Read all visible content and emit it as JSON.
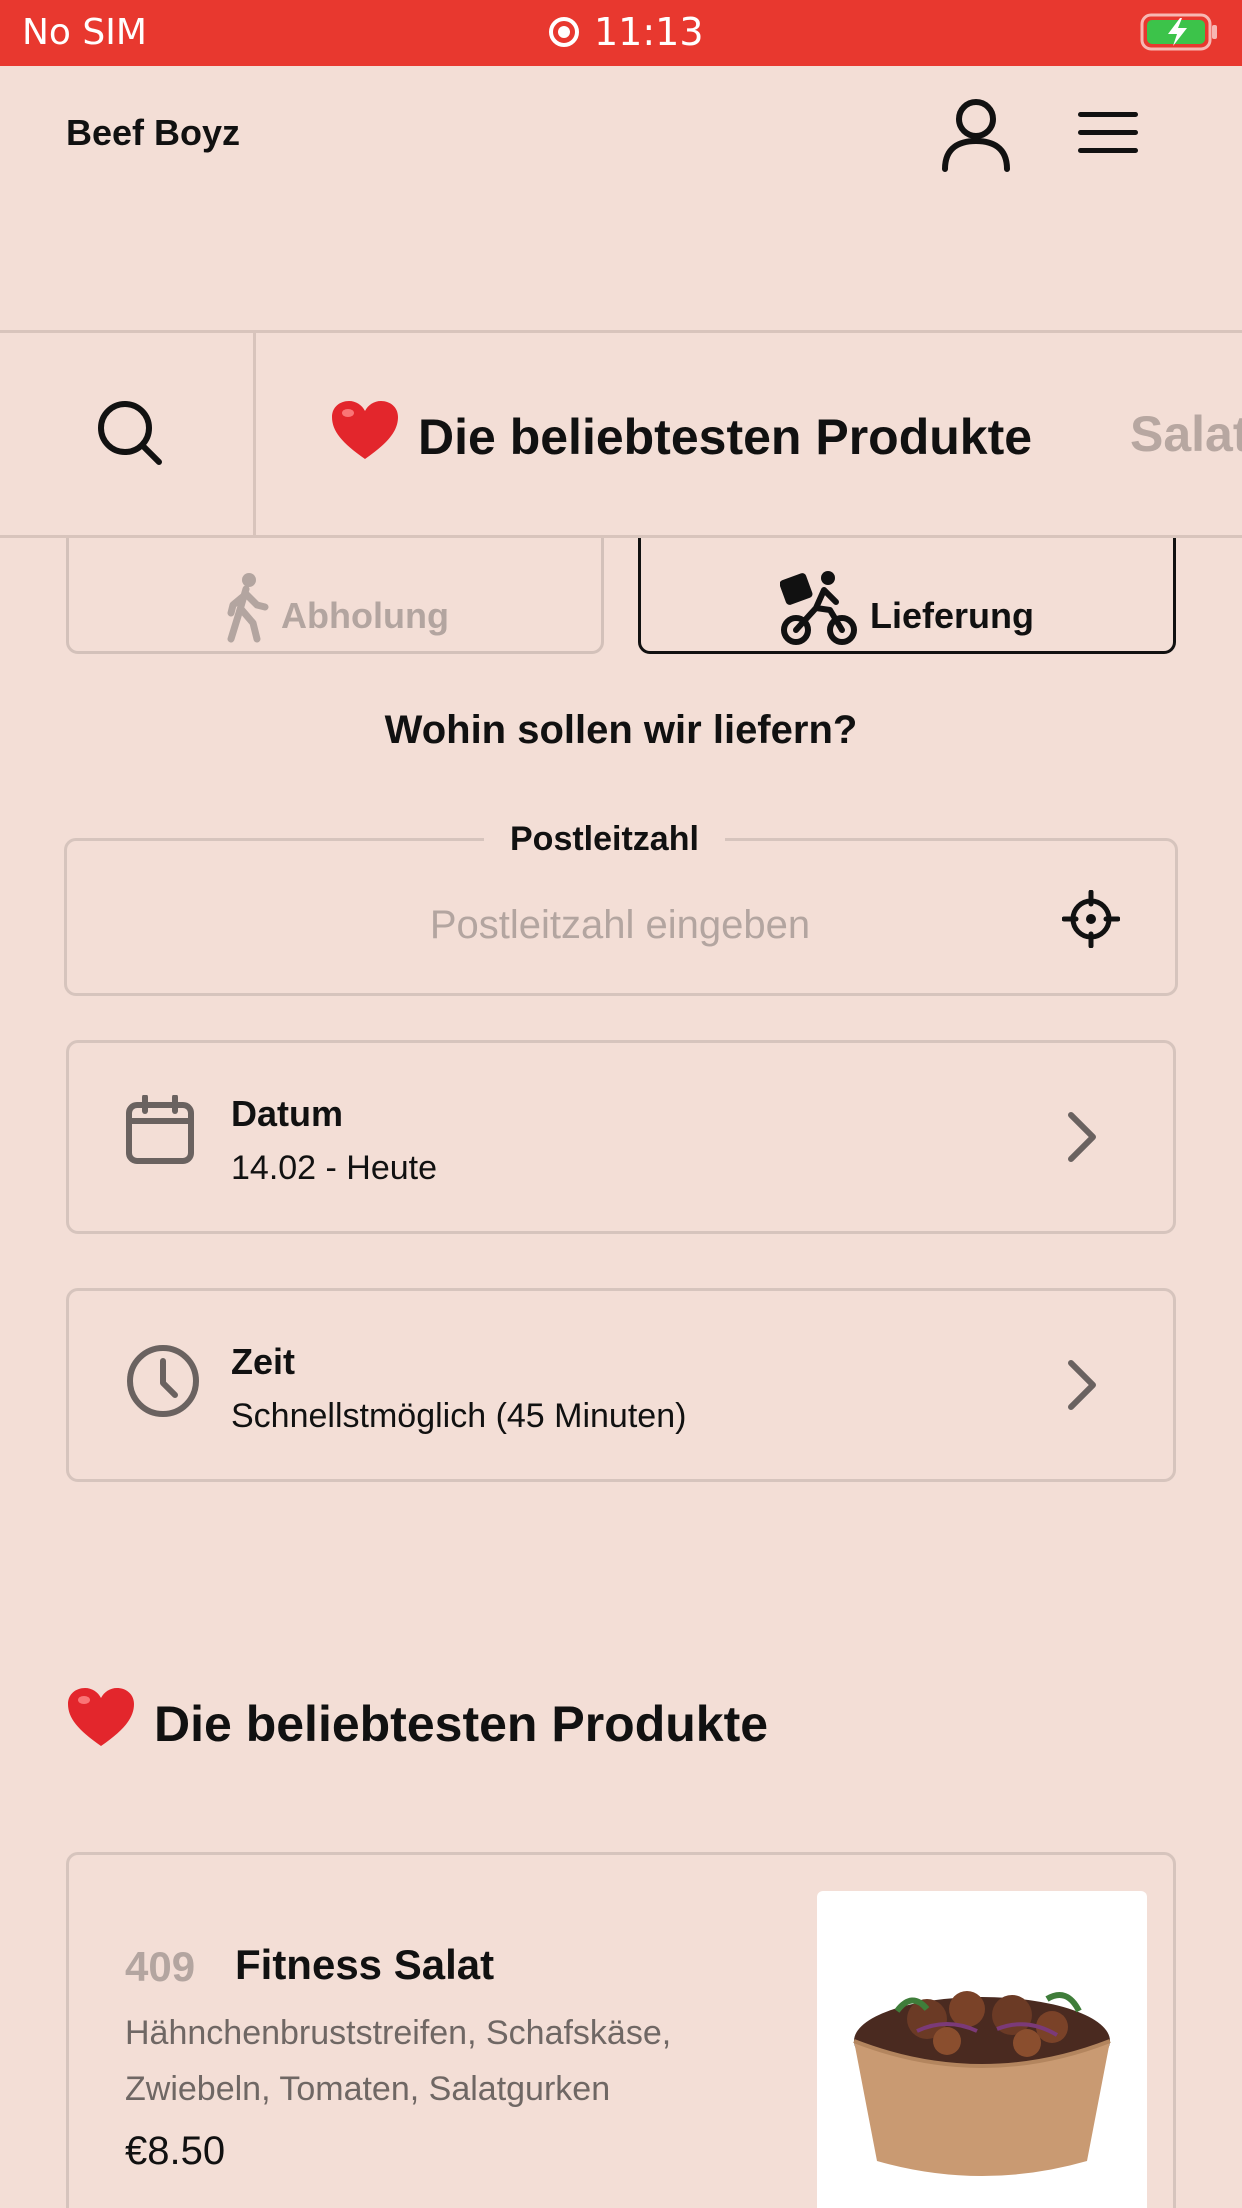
{
  "status_bar": {
    "carrier": "No SIM",
    "time": "11:13",
    "battery_color": "#3cc34a"
  },
  "header": {
    "brand": "Beef Boyz",
    "account_icon": "user-icon",
    "menu_icon": "hamburger-menu-icon"
  },
  "category_bar": {
    "search_icon": "search-icon",
    "active_emoji": "❤️",
    "active_label": "Die beliebtesten Produkte",
    "next_label": "Salat"
  },
  "mode_tabs": {
    "pickup_label": "Abholung",
    "delivery_label": "Lieferung",
    "selected": "delivery"
  },
  "delivery_form": {
    "question": "Wohin sollen wir liefern?",
    "postal_legend": "Postleitzahl",
    "postal_value": "",
    "postal_placeholder": "Postleitzahl eingeben",
    "date_title": "Datum",
    "date_value": "14.02 - Heute",
    "time_title": "Zeit",
    "time_value": "Schnellstmöglich (45 Minuten)"
  },
  "section": {
    "emoji": "❤️",
    "title": "Die beliebtesten Produkte"
  },
  "product": {
    "number": "409",
    "name": "Fitness Salat",
    "description": "Hähnchenbruststreifen, Schafskäse, Zwiebeln, Tomaten, Salatgurken",
    "price": "€8.50"
  },
  "colors": {
    "background": "#f3ded6",
    "status_bar": "#e8382f",
    "border": "#d6c4bd",
    "muted_text": "#b3a5a0",
    "heart": "#e3262c"
  }
}
